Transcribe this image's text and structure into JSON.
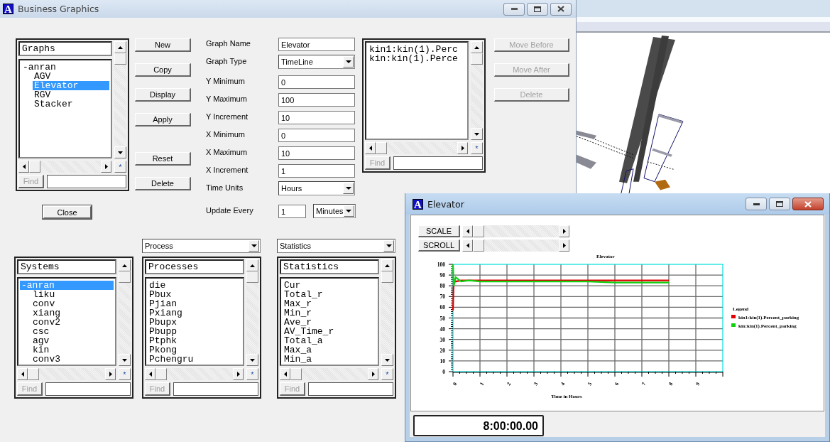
{
  "main_window": {
    "title": "Business Graphics",
    "logo": "A",
    "active": false,
    "graphs_panel": {
      "header": "Graphs",
      "star": "*",
      "find": {
        "label": "Find",
        "disabled": true
      },
      "items": [
        {
          "label": "-anran",
          "selected": false,
          "children": [
            {
              "label": "AGV",
              "selected": false
            },
            {
              "label": "Elevator",
              "selected": true
            },
            {
              "label": "RGV",
              "selected": false
            },
            {
              "label": "Stacker",
              "selected": false
            }
          ]
        }
      ]
    },
    "close_button": "Close",
    "button_groups": [
      [
        "New",
        "Copy",
        "Display",
        "Apply"
      ],
      [
        "Reset",
        "Delete"
      ]
    ],
    "form": [
      {
        "label": "Graph Name",
        "kind": "text",
        "value": "Elevator"
      },
      {
        "label": "Graph Type",
        "kind": "select",
        "value": "TimeLine"
      },
      {
        "label": "Y Minimum",
        "kind": "text",
        "value": "0"
      },
      {
        "label": "Y Maximum",
        "kind": "text",
        "value": "100"
      },
      {
        "label": "Y Increment",
        "kind": "text",
        "value": "10"
      },
      {
        "label": "X Minimum",
        "kind": "text",
        "value": "0"
      },
      {
        "label": "X Maximum",
        "kind": "text",
        "value": "10"
      },
      {
        "label": "X Increment",
        "kind": "text",
        "value": "1"
      },
      {
        "label": "Time Units",
        "kind": "select",
        "value": "Hours"
      },
      {
        "label": "Update Every",
        "kind": "pair",
        "value": "1",
        "unit": "Minutes"
      }
    ],
    "series_panel": {
      "star": "*",
      "find": {
        "label": "Find",
        "disabled": true
      },
      "items": [
        {
          "label": "kin1:kin(1).Perc",
          "selected": false
        },
        {
          "label": "kin:kin(1).Perce",
          "selected": false
        }
      ]
    },
    "side_buttons": [
      {
        "label": "Move Before",
        "disabled": true
      },
      {
        "label": "Move After",
        "disabled": true
      },
      {
        "label": "Delete",
        "disabled": true
      }
    ],
    "bottom_panels": [
      {
        "header": "Systems",
        "star": "*",
        "find": {
          "label": "Find",
          "disabled": true
        },
        "items": [
          {
            "label": "-anran",
            "selected": true,
            "children": [
              {
                "label": "liku",
                "selected": false
              },
              {
                "label": "conv",
                "selected": false
              },
              {
                "label": "xiang",
                "selected": false
              },
              {
                "label": "conv2",
                "selected": false
              },
              {
                "label": "csc",
                "selected": false
              },
              {
                "label": "agv",
                "selected": false
              },
              {
                "label": "kin",
                "selected": false
              },
              {
                "label": "conv3",
                "selected": false
              }
            ]
          }
        ]
      },
      {
        "dropdown": "Process",
        "header": "Processes",
        "star": "*",
        "find": {
          "label": "Find",
          "disabled": true
        },
        "items": [
          {
            "label": "die",
            "selected": false
          },
          {
            "label": "Pbux",
            "selected": false
          },
          {
            "label": "Pjian",
            "selected": false
          },
          {
            "label": "Pxiang",
            "selected": false
          },
          {
            "label": "Pbupx",
            "selected": false
          },
          {
            "label": "Pbupp",
            "selected": false
          },
          {
            "label": "Ptphk",
            "selected": false
          },
          {
            "label": "Pkong",
            "selected": false
          },
          {
            "label": "Pchengru",
            "selected": false
          }
        ]
      },
      {
        "dropdown": "Statistics",
        "header": "Statistics",
        "star": "*",
        "find": {
          "label": "Find",
          "disabled": true
        },
        "items": [
          {
            "label": "Cur",
            "selected": false
          },
          {
            "label": "Total_r",
            "selected": false
          },
          {
            "label": "Max_r",
            "selected": false
          },
          {
            "label": "Min_r",
            "selected": false
          },
          {
            "label": "Ave_r",
            "selected": false
          },
          {
            "label": "AV_Time_r",
            "selected": false
          },
          {
            "label": "Total_a",
            "selected": false
          },
          {
            "label": "Max_a",
            "selected": false
          },
          {
            "label": "Min_a",
            "selected": false
          }
        ]
      }
    ]
  },
  "graph_window": {
    "title": "Elevator",
    "logo": "A",
    "active": true,
    "scale_button": "SCALE",
    "scroll_button": "SCROLL",
    "clock": "8:00:00.00",
    "chart_data": {
      "type": "line",
      "title": "Elevator",
      "xlabel": "Time in Hours",
      "x": [
        0,
        0.03,
        0.1,
        0.3,
        0.6,
        1,
        2,
        3,
        4,
        5,
        6,
        7,
        8
      ],
      "series": [
        {
          "name": "kin1:kin(1).Percent_parking",
          "color": "#e00000",
          "values": [
            57,
            86,
            84,
            85,
            85,
            85,
            85,
            85,
            85,
            85,
            85,
            85,
            85
          ]
        },
        {
          "name": "kin:kin(1).Percent_parking",
          "color": "#10d010",
          "values": [
            100,
            80,
            88,
            84,
            85,
            84,
            84,
            84,
            84,
            84,
            83,
            83,
            83
          ]
        }
      ],
      "xlim": [
        0,
        10
      ],
      "ylim": [
        0,
        100
      ],
      "xticks": [
        0,
        1,
        2,
        3,
        4,
        5,
        6,
        7,
        8,
        9
      ],
      "yticks": [
        0,
        10,
        20,
        30,
        40,
        50,
        60,
        70,
        80,
        90,
        100
      ],
      "grid": true,
      "legend": {
        "title": "Legend"
      }
    }
  }
}
